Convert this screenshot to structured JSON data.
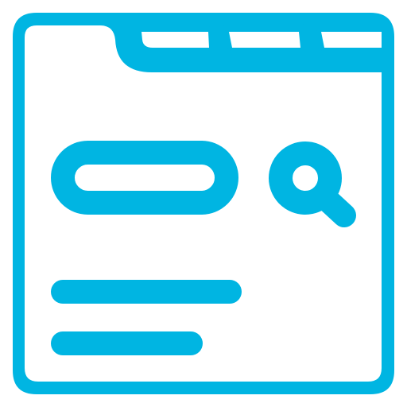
{
  "icon": {
    "name": "browser-search-icon",
    "color": "#00B5E2",
    "background": "#FFFFFF",
    "parts": {
      "window": "browser-window-icon",
      "tabs": [
        "tab-icon",
        "tab-icon",
        "tab-icon"
      ],
      "search_field": "search-field-icon",
      "search": "magnifier-icon",
      "content_lines": [
        "text-line-icon",
        "text-line-icon"
      ]
    }
  }
}
